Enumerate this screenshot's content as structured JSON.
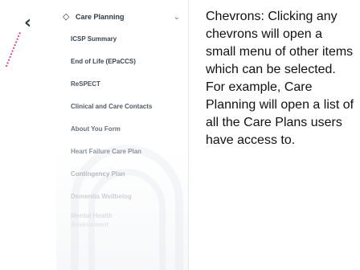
{
  "back_icon": "chevron-left-icon",
  "menu": {
    "header": {
      "icon": "diamond-icon",
      "label": "Care Planning",
      "chevron": "chevron-down-icon"
    },
    "items": [
      {
        "label": "ICSP Summary",
        "color": "#3b4552"
      },
      {
        "label": "End of Life (EPaCCS)",
        "color": "#3b4552"
      },
      {
        "label": "ReSPECT",
        "color": "#4a5360"
      },
      {
        "label": "Clinical and Care Contacts",
        "color": "#525b67"
      },
      {
        "label": "About You Form",
        "color": "#6a727d"
      },
      {
        "label": "Heart Failure Care Plan",
        "color": "#8c939c"
      },
      {
        "label": "Contingency Plan",
        "color": "#b3b8be"
      },
      {
        "label": "Dementia Wellbeing",
        "color": "#cdd1d5"
      },
      {
        "label": "Mental Health",
        "color": "#dcdfe2"
      },
      {
        "label": "Assessment",
        "color": "#e4e6e9"
      }
    ]
  },
  "description": "Chevrons: Clicking any chevrons will open a small menu of other items which can be selected. For example, Care Planning will open a list of all the Care Plans users have access to."
}
